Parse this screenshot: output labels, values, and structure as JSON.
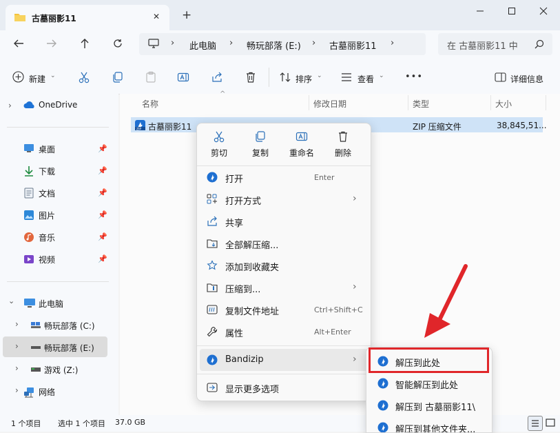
{
  "window": {
    "tab_title": "古墓丽影11",
    "new_tab_symbol": "+",
    "tab_close_symbol": "✕"
  },
  "address": {
    "breadcrumbs": [
      "此电脑",
      "畅玩部落 (E:)",
      "古墓丽影11"
    ],
    "search_placeholder": "在 古墓丽影11 中"
  },
  "toolbar": {
    "new_label": "新建",
    "sort_label": "排序",
    "view_label": "查看",
    "more_label": "•••",
    "details_label": "详细信息"
  },
  "nav": {
    "onedrive": "OneDrive",
    "quick": [
      "桌面",
      "下载",
      "文档",
      "图片",
      "音乐",
      "视频"
    ],
    "this_pc": "此电脑",
    "drives": [
      "畅玩部落 (C:)",
      "畅玩部落 (E:)",
      "游戏 (Z:)"
    ],
    "network": "网络"
  },
  "columns": {
    "name": "名称",
    "modified": "修改日期",
    "type": "类型",
    "size": "大小"
  },
  "file": {
    "name": "古墓丽影11",
    "type": "ZIP 压缩文件",
    "size": "38,845,51..."
  },
  "status": {
    "count": "1 个项目",
    "selected": "选中 1 个项目",
    "size": "37.0 GB"
  },
  "context_menu": {
    "quick": [
      "剪切",
      "复制",
      "重命名",
      "删除"
    ],
    "items": [
      {
        "label": "打开",
        "shortcut": "Enter"
      },
      {
        "label": "打开方式",
        "shortcut": ""
      },
      {
        "label": "共享",
        "shortcut": ""
      },
      {
        "label": "全部解压缩...",
        "shortcut": ""
      },
      {
        "label": "添加到收藏夹",
        "shortcut": ""
      },
      {
        "label": "压缩到...",
        "shortcut": ""
      },
      {
        "label": "复制文件地址",
        "shortcut": "Ctrl+Shift+C"
      },
      {
        "label": "属性",
        "shortcut": "Alt+Enter"
      }
    ],
    "bandizip": "Bandizip",
    "more_options": "显示更多选项"
  },
  "submenu": {
    "items": [
      "解压到此处",
      "智能解压到此处",
      "解压到 古墓丽影11\\",
      "解压到其他文件夹..."
    ]
  },
  "colors": {
    "highlight_box": "#e0262a",
    "arrow": "#e0262a",
    "selection": "#cfe3f7",
    "bandizip_blue": "#1e6fd1"
  }
}
